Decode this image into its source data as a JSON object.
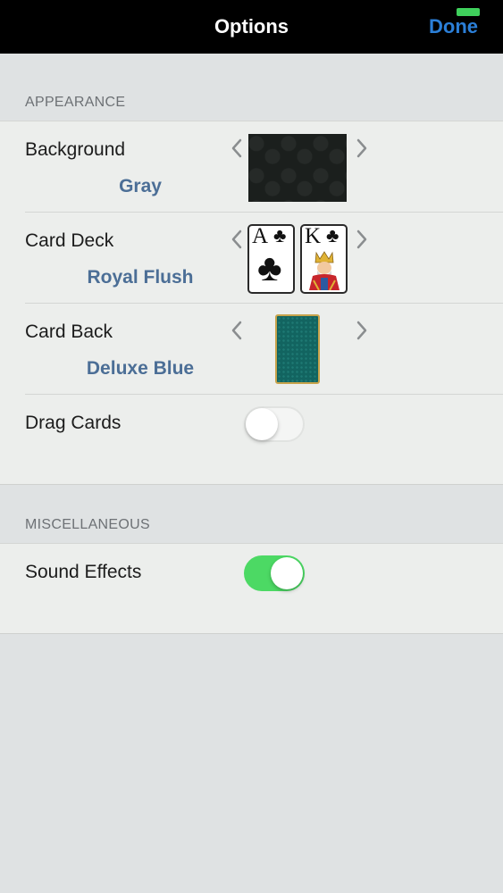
{
  "navbar": {
    "title": "Options",
    "done_label": "Done"
  },
  "appearance": {
    "header": "APPEARANCE",
    "background": {
      "label": "Background",
      "value": "Gray"
    },
    "card_deck": {
      "label": "Card Deck",
      "value": "Royal Flush",
      "card1_rank": "A",
      "card2_rank": "K",
      "suit_symbol": "♣"
    },
    "card_back": {
      "label": "Card Back",
      "value": "Deluxe Blue"
    },
    "drag_cards": {
      "label": "Drag Cards",
      "on": false
    }
  },
  "misc": {
    "header": "MISCELLANEOUS",
    "sound_effects": {
      "label": "Sound Effects",
      "on": true
    }
  },
  "colors": {
    "accent": "#2b7fd8",
    "value_text": "#4b6e96",
    "toggle_on": "#4cd964"
  }
}
